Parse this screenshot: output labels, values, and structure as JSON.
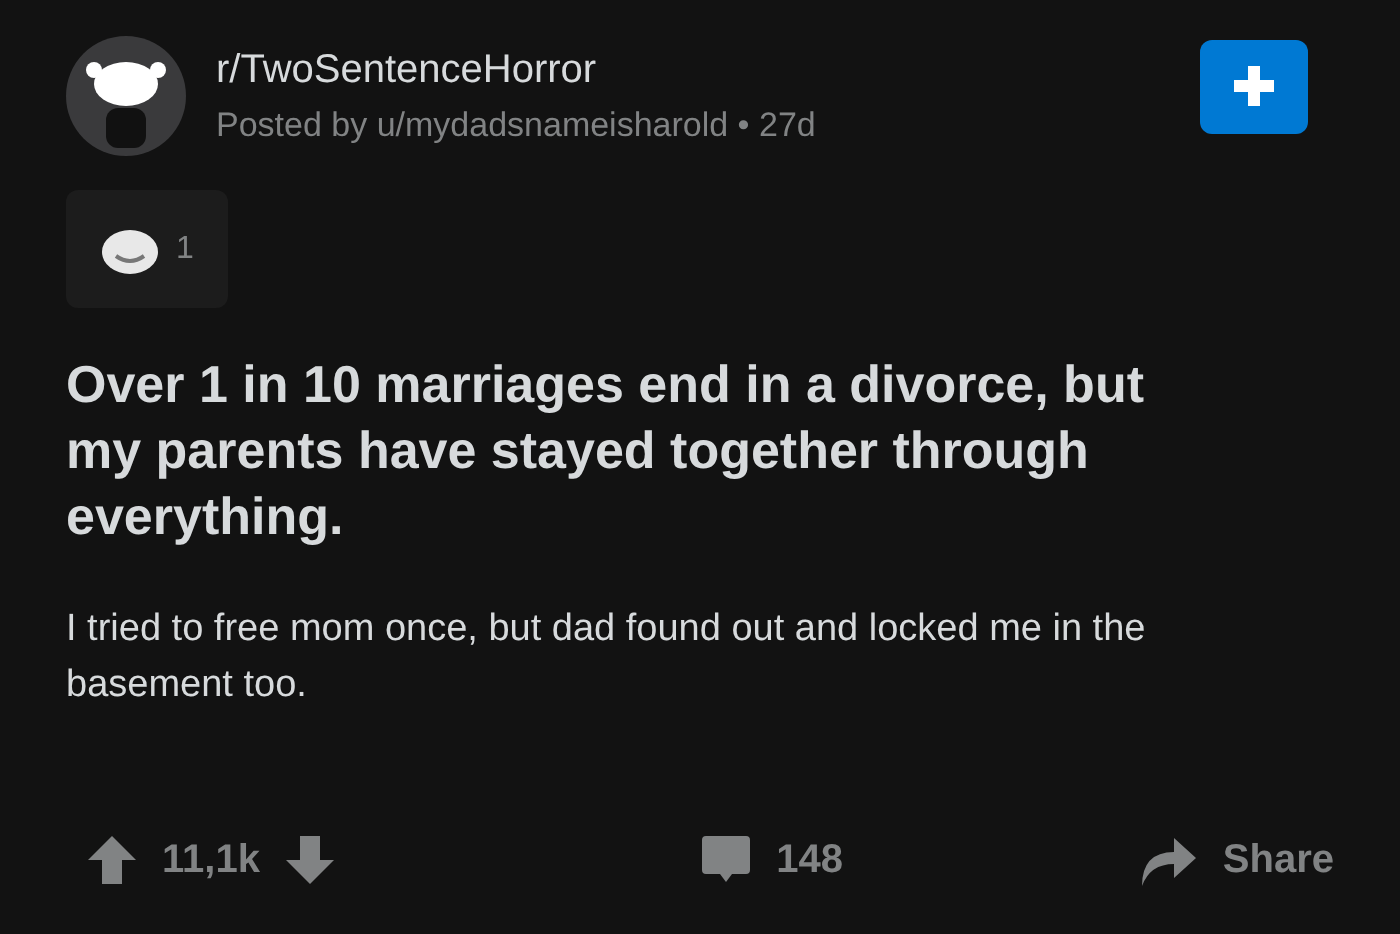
{
  "post": {
    "subreddit": "r/TwoSentenceHorror",
    "meta": "Posted by u/mydadsnameisharold • 27d",
    "award_count": "1",
    "title": "Over 1 in 10 marriages end in a divorce, but my parents have stayed together through everything.",
    "body": "I tried to free mom once, but dad found out and locked me in the basement too."
  },
  "actions": {
    "score": "11,1k",
    "comments": "148",
    "share": "Share"
  }
}
